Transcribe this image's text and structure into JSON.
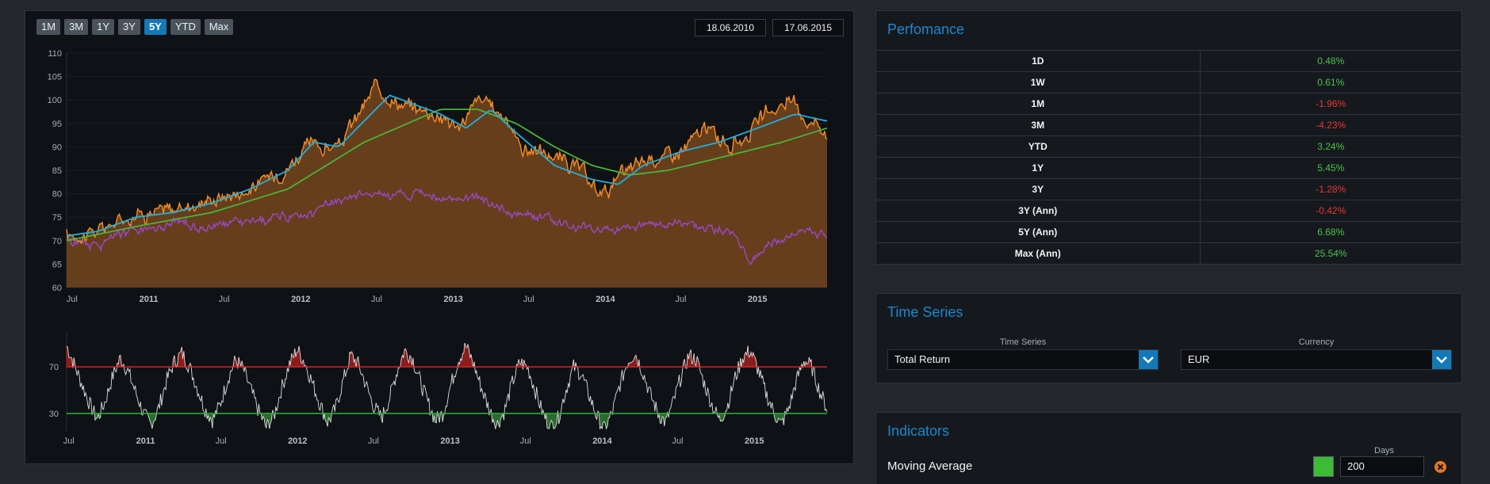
{
  "range_buttons": [
    "1M",
    "3M",
    "1Y",
    "3Y",
    "5Y",
    "YTD",
    "Max"
  ],
  "active_range": "5Y",
  "date_from": "18.06.2010",
  "date_to": "17.06.2015",
  "colors": {
    "price_line": "#f08a24",
    "price_fill": "#6b411c",
    "ma_short": "#1eb0e0",
    "ma_long": "#4ab43a",
    "relative": "#9a48c8",
    "rsi_line": "#dcdcdc",
    "rsi_upper": "#e02020",
    "rsi_lower": "#2ea83a",
    "accent": "#1f86cc",
    "positive": "#4cc14a",
    "negative": "#e6352f"
  },
  "chart_data": [
    {
      "type": "area",
      "ylim": [
        60,
        110
      ],
      "yticks": [
        60,
        65,
        70,
        75,
        80,
        85,
        90,
        95,
        100,
        105,
        110
      ],
      "x_range": [
        "2010-06-18",
        "2015-06-17"
      ],
      "x_ticks": [
        {
          "label": "Jul",
          "date": "2010-07-01",
          "bold": false
        },
        {
          "label": "2011",
          "date": "2011-01-01",
          "bold": true
        },
        {
          "label": "Jul",
          "date": "2011-07-01",
          "bold": false
        },
        {
          "label": "2012",
          "date": "2012-01-01",
          "bold": true
        },
        {
          "label": "Jul",
          "date": "2012-07-01",
          "bold": false
        },
        {
          "label": "2013",
          "date": "2013-01-01",
          "bold": true
        },
        {
          "label": "Jul",
          "date": "2013-07-01",
          "bold": false
        },
        {
          "label": "2014",
          "date": "2014-01-01",
          "bold": true
        },
        {
          "label": "Jul",
          "date": "2014-07-01",
          "bold": false
        },
        {
          "label": "2015",
          "date": "2015-01-01",
          "bold": true
        }
      ],
      "series": [
        {
          "role": "price",
          "x": [
            "2010-06-18",
            "2010-09-01",
            "2010-12-01",
            "2011-03-01",
            "2011-06-01",
            "2011-09-01",
            "2011-12-01",
            "2012-01-15",
            "2012-04-01",
            "2012-07-01",
            "2012-09-01",
            "2012-12-01",
            "2013-01-15",
            "2013-03-01",
            "2013-05-01",
            "2013-06-15",
            "2013-09-01",
            "2013-11-01",
            "2013-12-15",
            "2014-02-01",
            "2014-04-01",
            "2014-07-01",
            "2014-09-01",
            "2014-11-01",
            "2015-01-15",
            "2015-03-15",
            "2015-05-01",
            "2015-06-17"
          ],
          "values": [
            71,
            72,
            76,
            76.5,
            79,
            81,
            86,
            90,
            90,
            103,
            99,
            97,
            94,
            100,
            97,
            90,
            88,
            85,
            80,
            83,
            87,
            89,
            94,
            90,
            96,
            100,
            96,
            94
          ]
        },
        {
          "role": "ma_short",
          "x": [
            "2010-06-18",
            "2010-09-01",
            "2010-12-01",
            "2011-03-01",
            "2011-06-01",
            "2011-09-01",
            "2011-12-01",
            "2012-02-01",
            "2012-04-01",
            "2012-08-01",
            "2012-12-01",
            "2013-02-01",
            "2013-04-01",
            "2013-06-01",
            "2013-09-01",
            "2013-12-01",
            "2014-02-01",
            "2014-04-01",
            "2014-07-01",
            "2014-10-01",
            "2015-01-01",
            "2015-04-01",
            "2015-06-17"
          ],
          "values": [
            71,
            72,
            75,
            76,
            78,
            81,
            85,
            91,
            90,
            101,
            97,
            94,
            98,
            93,
            86,
            83,
            82,
            86,
            89,
            91,
            94,
            97,
            95.5
          ]
        },
        {
          "role": "ma_long",
          "x": [
            "2010-06-18",
            "2010-12-01",
            "2011-06-01",
            "2011-12-01",
            "2012-06-01",
            "2012-12-01",
            "2013-03-01",
            "2013-06-01",
            "2013-09-01",
            "2013-12-01",
            "2014-03-01",
            "2014-06-01",
            "2014-09-01",
            "2014-12-01",
            "2015-03-01",
            "2015-06-17"
          ],
          "values": [
            70,
            73,
            76,
            81,
            91,
            98,
            98,
            95,
            90,
            86,
            84,
            85,
            87,
            89,
            91,
            94
          ]
        },
        {
          "role": "relative",
          "x": [
            "2010-06-18",
            "2010-09-01",
            "2010-12-01",
            "2011-03-01",
            "2011-06-01",
            "2011-09-01",
            "2011-12-01",
            "2012-03-01",
            "2012-06-01",
            "2012-09-01",
            "2012-12-01",
            "2013-03-01",
            "2013-06-01",
            "2013-09-01",
            "2013-12-01",
            "2014-03-01",
            "2014-06-01",
            "2014-09-01",
            "2014-11-01",
            "2014-12-15",
            "2015-03-01",
            "2015-05-01",
            "2015-06-17"
          ],
          "values": [
            70,
            69.5,
            72,
            73.5,
            73,
            74,
            75,
            77,
            80,
            80,
            79,
            79,
            76,
            74,
            72,
            73,
            74,
            73,
            72,
            66,
            70,
            73,
            70
          ]
        }
      ]
    },
    {
      "type": "line",
      "yticks": [
        30,
        70
      ],
      "ylim": [
        15,
        100
      ],
      "thresholds": {
        "upper": 70,
        "lower": 30
      },
      "x_range": [
        "2010-06-18",
        "2015-06-17"
      ],
      "x_ticks": [
        {
          "label": "Jul",
          "date": "2010-07-01",
          "bold": false
        },
        {
          "label": "2011",
          "date": "2011-01-01",
          "bold": true
        },
        {
          "label": "Jul",
          "date": "2011-07-01",
          "bold": false
        },
        {
          "label": "2012",
          "date": "2012-01-01",
          "bold": true
        },
        {
          "label": "Jul",
          "date": "2012-07-01",
          "bold": false
        },
        {
          "label": "2013",
          "date": "2013-01-01",
          "bold": true
        },
        {
          "label": "Jul",
          "date": "2013-07-01",
          "bold": false
        },
        {
          "label": "2014",
          "date": "2014-01-01",
          "bold": true
        },
        {
          "label": "Jul",
          "date": "2014-07-01",
          "bold": false
        },
        {
          "label": "2015",
          "date": "2015-01-01",
          "bold": true
        }
      ],
      "values": [
        88,
        72,
        55,
        38,
        25,
        40,
        62,
        78,
        66,
        48,
        30,
        20,
        35,
        58,
        74,
        82,
        70,
        52,
        34,
        24,
        38,
        60,
        76,
        68,
        50,
        32,
        18,
        28,
        52,
        72,
        85,
        74,
        56,
        38,
        22,
        34,
        58,
        80,
        72,
        54,
        36,
        26,
        42,
        66,
        84,
        78,
        58,
        40,
        24,
        30,
        54,
        76,
        88,
        72,
        52,
        34,
        20,
        32,
        56,
        74,
        70,
        50,
        30,
        18,
        26,
        50,
        70,
        64,
        46,
        28,
        16,
        30,
        54,
        74,
        82,
        66,
        46,
        30,
        22,
        40,
        62,
        80,
        76,
        56,
        38,
        24,
        36,
        60,
        78,
        84,
        68,
        48,
        32,
        20,
        34,
        58,
        76,
        70,
        50,
        34
      ]
    }
  ],
  "performance": {
    "title": "Perfomance",
    "rows": [
      {
        "label": "1D",
        "value": "0.48%",
        "positive": true
      },
      {
        "label": "1W",
        "value": "0.61%",
        "positive": true
      },
      {
        "label": "1M",
        "value": "-1.96%",
        "positive": false
      },
      {
        "label": "3M",
        "value": "-4.23%",
        "positive": false
      },
      {
        "label": "YTD",
        "value": "3.24%",
        "positive": true
      },
      {
        "label": "1Y",
        "value": "5.45%",
        "positive": true
      },
      {
        "label": "3Y",
        "value": "-1.28%",
        "positive": false
      },
      {
        "label": "3Y (Ann)",
        "value": "-0.42%",
        "positive": false
      },
      {
        "label": "5Y (Ann)",
        "value": "6.68%",
        "positive": true
      },
      {
        "label": "Max (Ann)",
        "value": "25.54%",
        "positive": true
      }
    ]
  },
  "time_series": {
    "title": "Time Series",
    "series_label": "Time Series",
    "series_value": "Total Return",
    "currency_label": "Currency",
    "currency_value": "EUR"
  },
  "indicators": {
    "title": "Indicators",
    "days_label": "Days",
    "items": [
      {
        "name": "Moving Average",
        "days": "200",
        "color": "#3dbb34"
      }
    ]
  }
}
